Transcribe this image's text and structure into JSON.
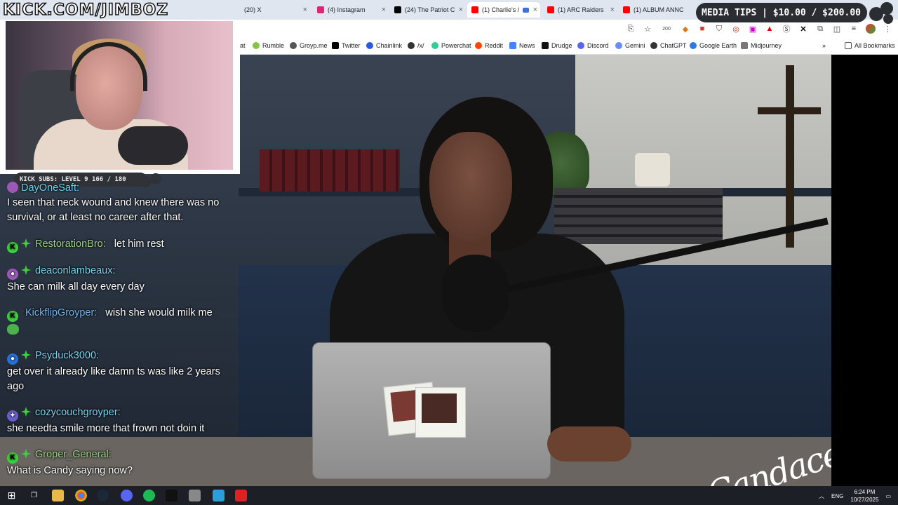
{
  "stream_overlay": {
    "channel_logo_text": "KICK.COM/JIMBOZ",
    "subs_bar": "KICK SUBS: LEVEL 9 166 / 180",
    "media_tips": "MEDIA TIPS | $10.00 / $200.00"
  },
  "browser": {
    "tabs": [
      {
        "label": "(20) X",
        "icon": "x-logo-icon",
        "color": "#000000"
      },
      {
        "label": "(4) Instagram",
        "icon": "instagram-icon",
        "color": "#d62976"
      },
      {
        "label": "(24) The Patriot C",
        "icon": "x-logo-icon",
        "color": "#000000"
      },
      {
        "label": "(1) Charlie's /",
        "icon": "youtube-icon",
        "color": "#ff0000"
      },
      {
        "label": "(1) ARC Raiders",
        "icon": "youtube-icon",
        "color": "#ff0000"
      },
      {
        "label": "(1) ALBUM ANNC",
        "icon": "youtube-icon",
        "color": "#ff0000"
      }
    ],
    "bookmarks": [
      {
        "label": "at",
        "icon": "bookmark-icon"
      },
      {
        "label": "Rumble",
        "icon": "rumble-icon"
      },
      {
        "label": "Groyp.me",
        "icon": "groyp-icon"
      },
      {
        "label": "Twitter",
        "icon": "x-logo-icon"
      },
      {
        "label": "Chainlink",
        "icon": "chainlink-icon"
      },
      {
        "label": "/x/",
        "icon": "board-icon"
      },
      {
        "label": "Powerchat",
        "icon": "powerchat-icon"
      },
      {
        "label": "Reddit",
        "icon": "reddit-icon"
      },
      {
        "label": "News",
        "icon": "news-icon"
      },
      {
        "label": "Drudge",
        "icon": "drudge-icon"
      },
      {
        "label": "Discord",
        "icon": "discord-icon"
      },
      {
        "label": "Gemini",
        "icon": "gemini-icon"
      },
      {
        "label": "ChatGPT",
        "icon": "chatgpt-icon"
      },
      {
        "label": "Google Earth",
        "icon": "google-earth-icon"
      },
      {
        "label": "Midjourney",
        "icon": "midjourney-icon"
      }
    ],
    "all_bookmarks": "All Bookmarks",
    "extension_badge": "200"
  },
  "video": {
    "signature": "Candace"
  },
  "chat": {
    "messages": [
      {
        "user": "DayOneSaft:",
        "text": "I seen that neck wound and knew there was no survival, or at least no career after that."
      },
      {
        "user": "RestorationBro:",
        "text": "let him rest"
      },
      {
        "user": "deaconlambeaux:",
        "text": "She can milk all day every day"
      },
      {
        "user": "KickflipGroyper:",
        "text": "wish she would milk me"
      },
      {
        "user": "Psyduck3000:",
        "text": "get over it already like damn ts was like 2 years ago"
      },
      {
        "user": "cozycouchgroyper:",
        "text": "she needta smile more that frown not doin it"
      },
      {
        "user": "Groper_General:",
        "text": "What is Candy saying now?"
      }
    ]
  },
  "taskbar": {
    "language": "ENG",
    "time": "6:24 PM",
    "date": "10/27/2025"
  }
}
